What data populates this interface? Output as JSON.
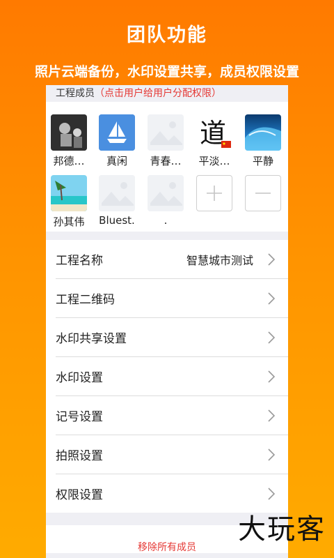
{
  "hero": {
    "title": "团队功能",
    "subtitle": "照片云端备份，水印设置共享，成员权限设置"
  },
  "members": {
    "header_label": "工程成员",
    "header_hint": "（点击用户给用户分配权限）",
    "items": [
      {
        "name": "邦德…",
        "avatar": "photo-dark"
      },
      {
        "name": "真闲",
        "avatar": "sailboat-icon"
      },
      {
        "name": "青春…",
        "avatar": "placeholder"
      },
      {
        "name": "平淡…",
        "avatar": "calligraphy-dao"
      },
      {
        "name": "平静",
        "avatar": "wave-photo"
      },
      {
        "name": "孙其伟",
        "avatar": "beach-photo"
      },
      {
        "name": "Bluest.",
        "avatar": "placeholder"
      },
      {
        "name": ".",
        "avatar": "placeholder"
      }
    ],
    "add_symbol": "+",
    "remove_symbol": "−",
    "calligraphy_char": "道"
  },
  "settings": {
    "project_name_label": "工程名称",
    "project_name_value": "智慧城市测试",
    "qrcode_label": "工程二维码",
    "watermark_share_label": "水印共享设置",
    "watermark_label": "水印设置",
    "mark_label": "记号设置",
    "photo_label": "拍照设置",
    "permission_label": "权限设置"
  },
  "remove_all_label": "移除所有成员",
  "brand_watermark": "大玩客",
  "colors": {
    "accent_orange": "#ff8a00",
    "danger_red": "#e53935",
    "panel_bg": "#efeff4"
  }
}
